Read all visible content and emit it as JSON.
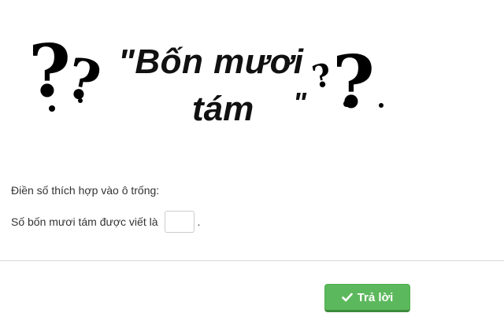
{
  "banner": {
    "title_line1": "\"Bốn mươi",
    "title_line2": "tám",
    "title_close": "\""
  },
  "question": {
    "instruction": "Điền số thích hợp vào ô trống:",
    "prompt": "Số bốn mươi tám được viết là",
    "answer_value": "",
    "suffix": "."
  },
  "actions": {
    "submit_label": "Trả lời",
    "submit_icon": "check-icon"
  },
  "colors": {
    "submit_bg": "#5cb85c",
    "title_text": "#111111"
  }
}
